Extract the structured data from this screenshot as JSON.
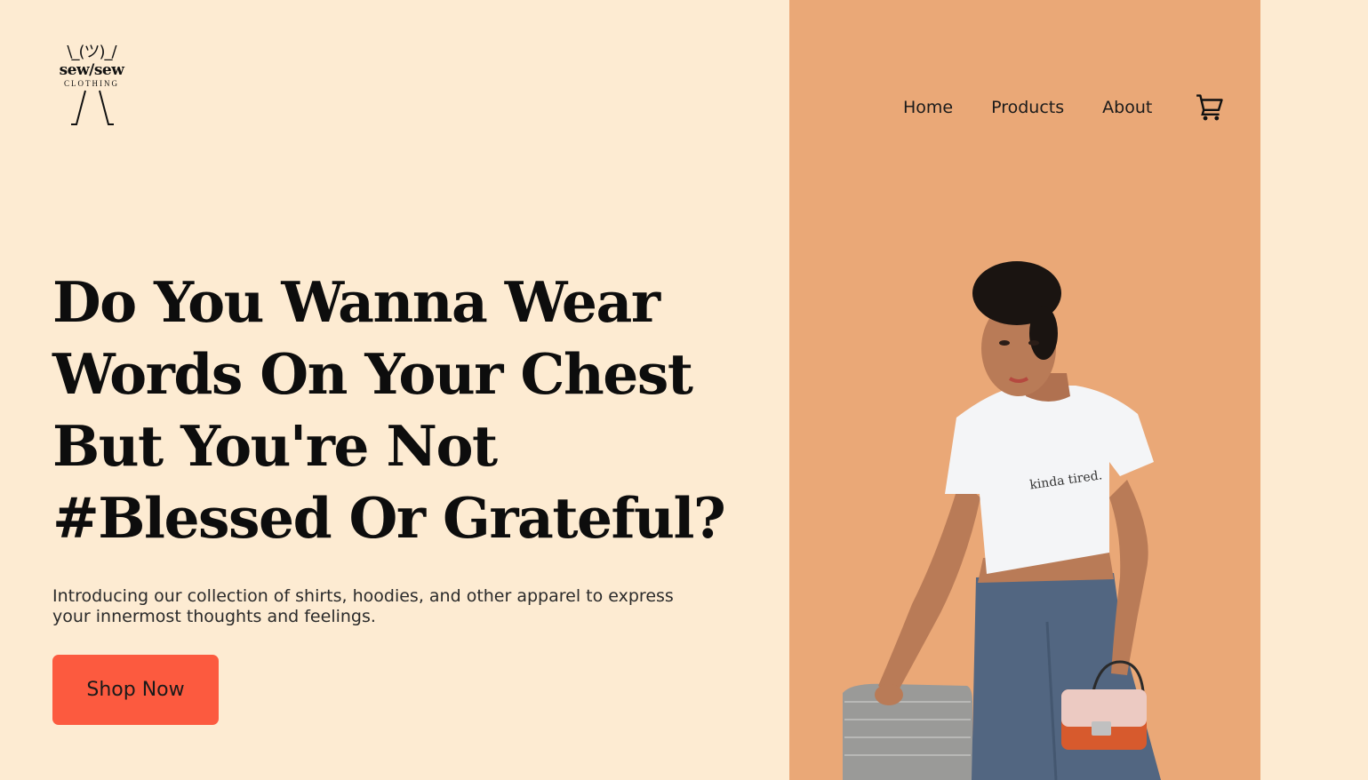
{
  "brand": {
    "shrug": "\\_(ツ)_/",
    "wordmark": "sew/sew",
    "subtitle": "CLOTHING"
  },
  "nav": {
    "items": [
      "Home",
      "Products",
      "About"
    ],
    "cart_icon": "shopping-cart-icon"
  },
  "hero": {
    "headline_lines": [
      "Do You Wanna Wear",
      "Words On Your Chest",
      "But You're Not",
      "#Blessed Or Grateful?"
    ],
    "description": "Introducing our collection of shirts, hoodies, and other apparel to express your innermost thoughts and feelings.",
    "cta_label": "Shop Now",
    "shirt_slogan": "kinda tired."
  },
  "colors": {
    "background": "#fdebd2",
    "panel": "#eaa877",
    "cta": "#fc5a3f"
  }
}
